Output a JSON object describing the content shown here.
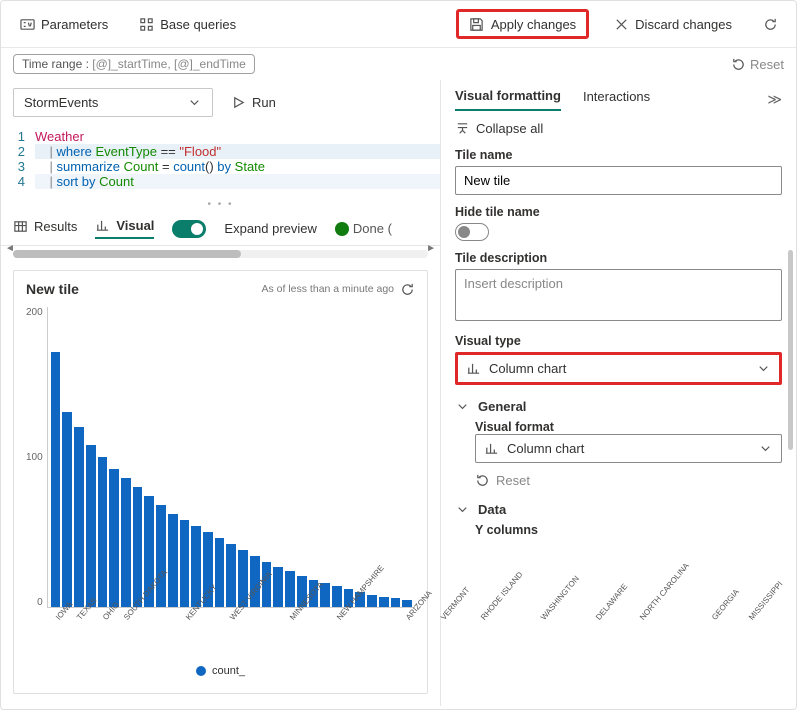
{
  "topbar": {
    "parameters": "Parameters",
    "base_queries": "Base queries",
    "apply_changes": "Apply changes",
    "discard_changes": "Discard changes"
  },
  "timerange": {
    "prefix": "Time range : ",
    "value": "[@]_startTime, [@]_endTime",
    "reset": "Reset"
  },
  "query": {
    "source": "StormEvents",
    "run": "Run",
    "lines": [
      {
        "n": 1,
        "tokens": [
          {
            "t": "Weather",
            "c": "tbl"
          }
        ]
      },
      {
        "n": 2,
        "tokens": [
          {
            "t": "    ",
            "c": ""
          },
          {
            "t": "|",
            "c": "pipe"
          },
          {
            "t": " ",
            "c": ""
          },
          {
            "t": "where",
            "c": "kw"
          },
          {
            "t": " ",
            "c": ""
          },
          {
            "t": "EventType",
            "c": "fld"
          },
          {
            "t": " == ",
            "c": "op"
          },
          {
            "t": "\"Flood\"",
            "c": "str"
          }
        ]
      },
      {
        "n": 3,
        "tokens": [
          {
            "t": "    ",
            "c": ""
          },
          {
            "t": "|",
            "c": "pipe"
          },
          {
            "t": " ",
            "c": ""
          },
          {
            "t": "summarize",
            "c": "kw"
          },
          {
            "t": " ",
            "c": ""
          },
          {
            "t": "Count",
            "c": "fld"
          },
          {
            "t": " = ",
            "c": "op"
          },
          {
            "t": "count",
            "c": "fn"
          },
          {
            "t": "() ",
            "c": "op"
          },
          {
            "t": "by",
            "c": "kw"
          },
          {
            "t": " ",
            "c": ""
          },
          {
            "t": "State",
            "c": "fld"
          }
        ]
      },
      {
        "n": 4,
        "tokens": [
          {
            "t": "    ",
            "c": ""
          },
          {
            "t": "|",
            "c": "pipe"
          },
          {
            "t": " ",
            "c": ""
          },
          {
            "t": "sort",
            "c": "kw"
          },
          {
            "t": " ",
            "c": ""
          },
          {
            "t": "by",
            "c": "kw"
          },
          {
            "t": " ",
            "c": ""
          },
          {
            "t": "Count",
            "c": "fld"
          }
        ]
      }
    ]
  },
  "results": {
    "tab_table": "Results",
    "tab_visual": "Visual",
    "expand_preview": "Expand preview",
    "status": "Done ("
  },
  "tile": {
    "title": "New tile",
    "as_of": "As of less than a minute ago"
  },
  "chart_data": {
    "type": "bar",
    "title": "New tile",
    "ylabel": "",
    "xlabel": "",
    "ylim": [
      0,
      200
    ],
    "yticks": [
      0,
      100,
      200
    ],
    "series_name": "count_",
    "categories": [
      "IOWA",
      "TEXAS",
      "",
      "OHIO",
      "",
      "",
      "SOUTH DAKOTA",
      "",
      "KENTUCKY",
      "",
      "WEST VIRGINIA",
      "",
      "MINNESOTA",
      "",
      "NEW HAMPSHIRE",
      "",
      "ARIZONA",
      "",
      "VERMONT",
      "",
      "RHODE ISLAND",
      "",
      "WASHINGTON",
      "",
      "DELAWARE",
      "",
      "NORTH CAROLINA",
      "",
      "GEORGIA",
      "",
      "MISSISSIPPI"
    ],
    "values": [
      170,
      130,
      120,
      108,
      100,
      92,
      86,
      80,
      74,
      68,
      62,
      58,
      54,
      50,
      46,
      42,
      38,
      34,
      30,
      27,
      24,
      21,
      18,
      16,
      14,
      12,
      10,
      8,
      7,
      6,
      5
    ]
  },
  "panel": {
    "tab_visual_formatting": "Visual formatting",
    "tab_interactions": "Interactions",
    "collapse_all": "Collapse all",
    "tile_name_label": "Tile name",
    "tile_name_value": "New tile",
    "hide_tile_name": "Hide tile name",
    "tile_description_label": "Tile description",
    "tile_description_placeholder": "Insert description",
    "visual_type_label": "Visual type",
    "visual_type_value": "Column chart",
    "general": "General",
    "visual_format_label": "Visual format",
    "visual_format_value": "Column chart",
    "reset": "Reset",
    "data": "Data",
    "y_columns": "Y columns"
  }
}
